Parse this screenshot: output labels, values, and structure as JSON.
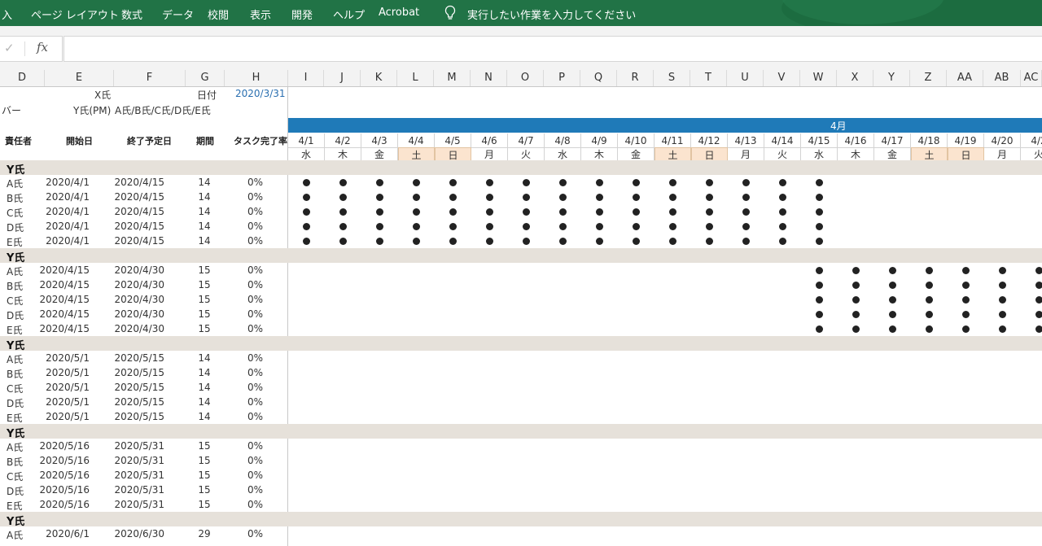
{
  "ribbon": {
    "tabs": [
      "入",
      "ページ レイアウト",
      "数式",
      "データ",
      "校閲",
      "表示",
      "開発",
      "ヘルプ",
      "Acrobat"
    ],
    "tellme": "実行したい作業を入力してください"
  },
  "formula_bar": {
    "confirm_glyph": "✓",
    "fx": "fx",
    "value": ""
  },
  "columns": [
    "D",
    "E",
    "F",
    "G",
    "H",
    "I",
    "J",
    "K",
    "L",
    "M",
    "N",
    "O",
    "P",
    "Q",
    "R",
    "S",
    "T",
    "U",
    "V",
    "W",
    "X",
    "Y",
    "Z",
    "AA",
    "AB",
    "AC"
  ],
  "info": {
    "owner": "X氏",
    "date_label": "日付",
    "date_value": "2020/3/31",
    "member_label": "バー",
    "pm": "Y氏(PM)",
    "members": "A氏/B氏/C氏/D氏/E氏"
  },
  "table_headers": {
    "assignee": "責任者",
    "start": "開始日",
    "end": "終了予定日",
    "duration": "期間",
    "completion": "タスク完了率"
  },
  "calendar": {
    "month": "4月",
    "dates": [
      "4/1",
      "4/2",
      "4/3",
      "4/4",
      "4/5",
      "4/6",
      "4/7",
      "4/8",
      "4/9",
      "4/10",
      "4/11",
      "4/12",
      "4/13",
      "4/14",
      "4/15",
      "4/16",
      "4/17",
      "4/18",
      "4/19",
      "4/20",
      "4/2"
    ],
    "weekdays": [
      "水",
      "木",
      "金",
      "土",
      "日",
      "月",
      "火",
      "水",
      "木",
      "金",
      "土",
      "日",
      "月",
      "火",
      "水",
      "木",
      "金",
      "土",
      "日",
      "月",
      "火"
    ],
    "weekend_flags": [
      false,
      false,
      false,
      true,
      true,
      false,
      false,
      false,
      false,
      false,
      true,
      true,
      false,
      false,
      false,
      false,
      false,
      true,
      true,
      false,
      false
    ]
  },
  "sections": [
    {
      "label": "Y氏",
      "dot_from": 0,
      "dot_to": 14,
      "rows": [
        {
          "name": "A氏",
          "start": "2020/4/1",
          "end": "2020/4/15",
          "days": "14",
          "pct": "0%"
        },
        {
          "name": "B氏",
          "start": "2020/4/1",
          "end": "2020/4/15",
          "days": "14",
          "pct": "0%"
        },
        {
          "name": "C氏",
          "start": "2020/4/1",
          "end": "2020/4/15",
          "days": "14",
          "pct": "0%"
        },
        {
          "name": "D氏",
          "start": "2020/4/1",
          "end": "2020/4/15",
          "days": "14",
          "pct": "0%"
        },
        {
          "name": "E氏",
          "start": "2020/4/1",
          "end": "2020/4/15",
          "days": "14",
          "pct": "0%"
        }
      ]
    },
    {
      "label": "Y氏",
      "dot_from": 14,
      "dot_to": 20,
      "rows": [
        {
          "name": "A氏",
          "start": "2020/4/15",
          "end": "2020/4/30",
          "days": "15",
          "pct": "0%"
        },
        {
          "name": "B氏",
          "start": "2020/4/15",
          "end": "2020/4/30",
          "days": "15",
          "pct": "0%"
        },
        {
          "name": "C氏",
          "start": "2020/4/15",
          "end": "2020/4/30",
          "days": "15",
          "pct": "0%"
        },
        {
          "name": "D氏",
          "start": "2020/4/15",
          "end": "2020/4/30",
          "days": "15",
          "pct": "0%"
        },
        {
          "name": "E氏",
          "start": "2020/4/15",
          "end": "2020/4/30",
          "days": "15",
          "pct": "0%"
        }
      ]
    },
    {
      "label": "Y氏",
      "dot_from": -1,
      "dot_to": -1,
      "rows": [
        {
          "name": "A氏",
          "start": "2020/5/1",
          "end": "2020/5/15",
          "days": "14",
          "pct": "0%"
        },
        {
          "name": "B氏",
          "start": "2020/5/1",
          "end": "2020/5/15",
          "days": "14",
          "pct": "0%"
        },
        {
          "name": "C氏",
          "start": "2020/5/1",
          "end": "2020/5/15",
          "days": "14",
          "pct": "0%"
        },
        {
          "name": "D氏",
          "start": "2020/5/1",
          "end": "2020/5/15",
          "days": "14",
          "pct": "0%"
        },
        {
          "name": "E氏",
          "start": "2020/5/1",
          "end": "2020/5/15",
          "days": "14",
          "pct": "0%"
        }
      ]
    },
    {
      "label": "Y氏",
      "dot_from": -1,
      "dot_to": -1,
      "rows": [
        {
          "name": "A氏",
          "start": "2020/5/16",
          "end": "2020/5/31",
          "days": "15",
          "pct": "0%"
        },
        {
          "name": "B氏",
          "start": "2020/5/16",
          "end": "2020/5/31",
          "days": "15",
          "pct": "0%"
        },
        {
          "name": "C氏",
          "start": "2020/5/16",
          "end": "2020/5/31",
          "days": "15",
          "pct": "0%"
        },
        {
          "name": "D氏",
          "start": "2020/5/16",
          "end": "2020/5/31",
          "days": "15",
          "pct": "0%"
        },
        {
          "name": "E氏",
          "start": "2020/5/16",
          "end": "2020/5/31",
          "days": "15",
          "pct": "0%"
        }
      ]
    },
    {
      "label": "Y氏",
      "dot_from": -1,
      "dot_to": -1,
      "rows": [
        {
          "name": "A氏",
          "start": "2020/6/1",
          "end": "2020/6/30",
          "days": "29",
          "pct": "0%"
        }
      ]
    }
  ],
  "colors": {
    "ribbon": "#217346",
    "month_bar": "#1f7ab8",
    "section_band": "#e6e1da",
    "weekend": "#fbe4cf",
    "date_value": "#2a6fb0"
  }
}
